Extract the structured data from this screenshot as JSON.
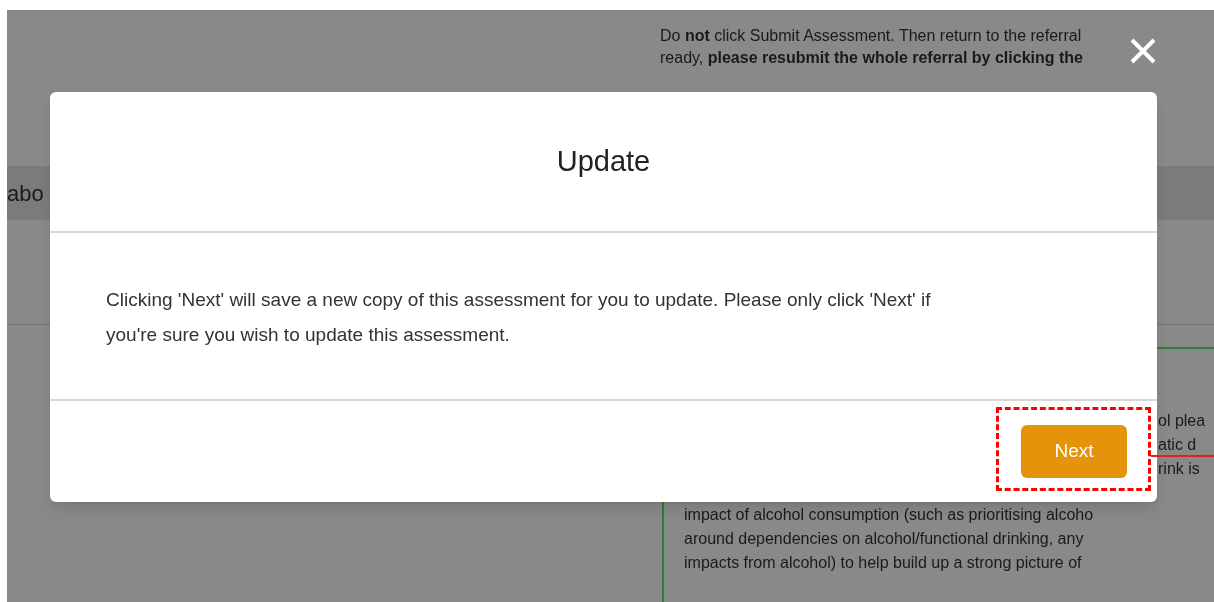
{
  "background": {
    "notice_lines": [
      "Do **not** click Submit Assessment. Then return to the referral",
      "ready, **please resubmit the whole referral by clicking the**"
    ],
    "tab_label": "abo",
    "guidance_fragments": [
      "ol plea",
      "atic d",
      "rink is"
    ],
    "guidance_lines": [
      "impact of alcohol consumption (such as prioritising alcoho",
      "around dependencies on alcohol/functional drinking, any",
      "impacts from alcohol) to help build up a strong picture of"
    ]
  },
  "modal": {
    "title": "Update",
    "message": "Clicking 'Next' will save a new copy of this assessment for you to update. Please only click 'Next' if you're sure you wish to update this assessment.",
    "next_button": {
      "label": "Next",
      "highlighted": true
    }
  }
}
